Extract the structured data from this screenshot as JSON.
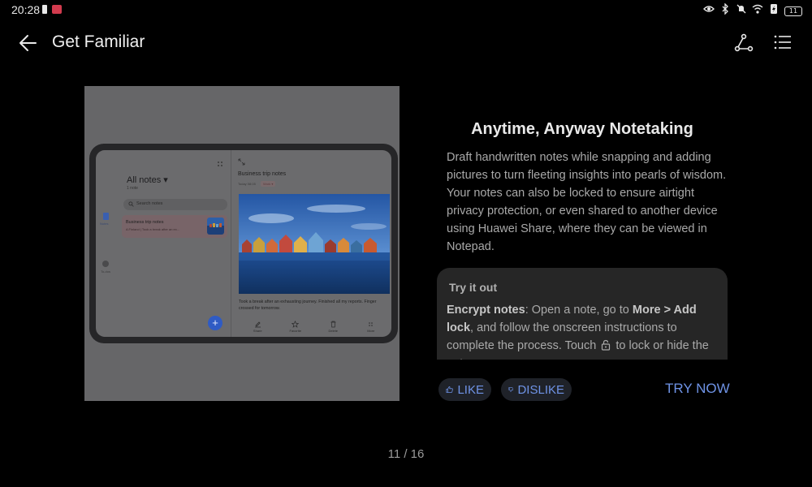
{
  "status_bar": {
    "time": "20:28",
    "battery_level": "11",
    "icons": [
      "eye-icon",
      "bluetooth-icon",
      "mute-icon",
      "wifi-icon",
      "battery-saver-icon",
      "battery-icon"
    ]
  },
  "header": {
    "title": "Get Familiar",
    "back_icon": "arrow-left-icon",
    "share_icon": "share-icon",
    "menu_icon": "list-icon"
  },
  "preview": {
    "all_notes": "All notes ▾",
    "notes_count": "1 note",
    "search_placeholder": "Search notes",
    "nav_notes": "Notes",
    "nav_todos": "To-dos",
    "card_title": "Business trip notes",
    "card_subtitle": "A Finland  |  Took a break after an ex...",
    "fab": "+",
    "detail_title": "Business trip notes",
    "detail_date": "Today 08:05",
    "detail_tag": "Work ▾",
    "detail_text": "Took a break after an exhausting journey. Finished all my reports. Finger crossed for tomorrow.",
    "tools": [
      "Share",
      "Favorite",
      "Delete",
      "More"
    ]
  },
  "feature": {
    "title": "Anytime, Anyway Notetaking",
    "description": "Draft handwritten notes while snapping and adding pictures to turn fleeting insights into pearls of wisdom. Your notes can also be locked to ensure airtight privacy protection, or even shared to another device using Huawei Share, where they can be viewed in Notepad."
  },
  "try_it_out": {
    "title": "Try it out",
    "term": "Encrypt notes",
    "text_1": ": Open a note, go to ",
    "path": "More > Add lock",
    "text_2": ", and follow the onscreen instructions to complete the process. Touch ",
    "text_3": " to lock or hide the note."
  },
  "actions": {
    "like": "LIKE",
    "dislike": "DISLIKE",
    "try_now": "TRY NOW"
  },
  "pager": "11 / 16",
  "colors": {
    "accent": "#6f93e6",
    "background": "#000000",
    "card": "#262626"
  }
}
